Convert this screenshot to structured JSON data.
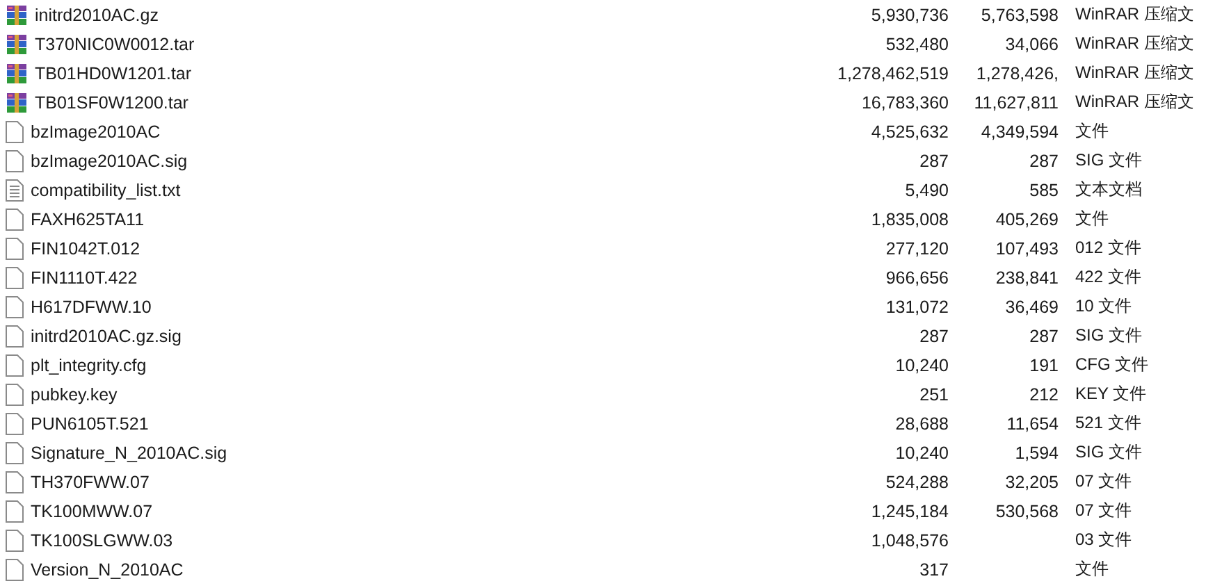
{
  "files": [
    {
      "kind": "archive",
      "name": "initrd2010AC.gz",
      "size": "5,930,736",
      "packed": "5,763,598",
      "type": "WinRAR 压缩文"
    },
    {
      "kind": "archive",
      "name": "T370NIC0W0012.tar",
      "size": "532,480",
      "packed": "34,066",
      "type": "WinRAR 压缩文"
    },
    {
      "kind": "archive",
      "name": "TB01HD0W1201.tar",
      "size": "1,278,462,519",
      "packed": "1,278,426,",
      "type": "WinRAR 压缩文"
    },
    {
      "kind": "archive",
      "name": "TB01SF0W1200.tar",
      "size": "16,783,360",
      "packed": "11,627,811",
      "type": "WinRAR 压缩文"
    },
    {
      "kind": "file",
      "name": "bzImage2010AC",
      "size": "4,525,632",
      "packed": "4,349,594",
      "type": "文件"
    },
    {
      "kind": "file",
      "name": "bzImage2010AC.sig",
      "size": "287",
      "packed": "287",
      "type": "SIG 文件"
    },
    {
      "kind": "text",
      "name": "compatibility_list.txt",
      "size": "5,490",
      "packed": "585",
      "type": "文本文档"
    },
    {
      "kind": "file",
      "name": "FAXH625TA11",
      "size": "1,835,008",
      "packed": "405,269",
      "type": "文件"
    },
    {
      "kind": "file",
      "name": "FIN1042T.012",
      "size": "277,120",
      "packed": "107,493",
      "type": "012 文件"
    },
    {
      "kind": "file",
      "name": "FIN1110T.422",
      "size": "966,656",
      "packed": "238,841",
      "type": "422 文件"
    },
    {
      "kind": "file",
      "name": "H617DFWW.10",
      "size": "131,072",
      "packed": "36,469",
      "type": "10 文件"
    },
    {
      "kind": "file",
      "name": "initrd2010AC.gz.sig",
      "size": "287",
      "packed": "287",
      "type": "SIG 文件"
    },
    {
      "kind": "file",
      "name": "plt_integrity.cfg",
      "size": "10,240",
      "packed": "191",
      "type": "CFG 文件"
    },
    {
      "kind": "file",
      "name": "pubkey.key",
      "size": "251",
      "packed": "212",
      "type": "KEY 文件"
    },
    {
      "kind": "file",
      "name": "PUN6105T.521",
      "size": "28,688",
      "packed": "11,654",
      "type": "521 文件"
    },
    {
      "kind": "file",
      "name": "Signature_N_2010AC.sig",
      "size": "10,240",
      "packed": "1,594",
      "type": "SIG 文件"
    },
    {
      "kind": "file",
      "name": "TH370FWW.07",
      "size": "524,288",
      "packed": "32,205",
      "type": "07 文件"
    },
    {
      "kind": "file",
      "name": "TK100MWW.07",
      "size": "1,245,184",
      "packed": "530,568",
      "type": "07 文件"
    },
    {
      "kind": "file",
      "name": "TK100SLGWW.03",
      "size": "1,048,576",
      "type": "03 文件"
    },
    {
      "kind": "file",
      "name": "Version_N_2010AC",
      "size": "317",
      "type": "文件"
    }
  ]
}
